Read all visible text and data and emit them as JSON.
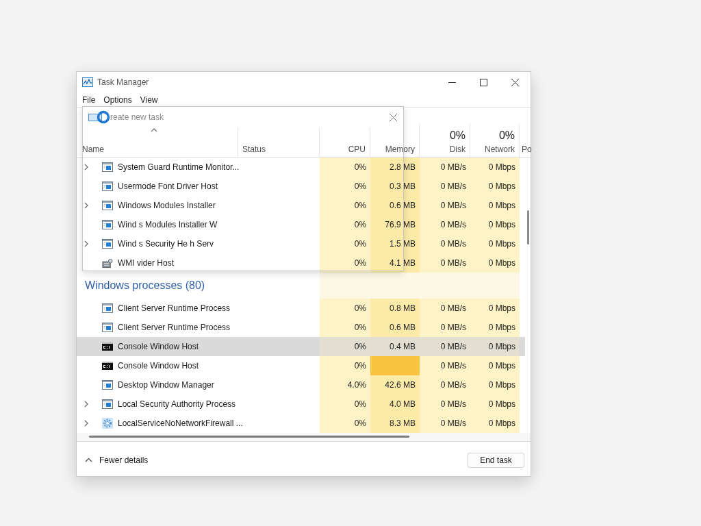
{
  "window": {
    "title": "Task Manager"
  },
  "menu": [
    "File",
    "Options",
    "View"
  ],
  "dialog": {
    "title": "reate new task"
  },
  "columns": [
    {
      "label": "Name"
    },
    {
      "label": "Status"
    },
    {
      "label": "CPU"
    },
    {
      "label": "Memory"
    },
    {
      "label": "Disk",
      "total": "0%"
    },
    {
      "label": "Network",
      "total": "0%"
    },
    {
      "label": "Po"
    }
  ],
  "rows": [
    {
      "kind": "app",
      "name": "System Guard Runtime Monitor...",
      "expandable": true,
      "selected": false,
      "memory_alert": false,
      "cpu": "0%",
      "memory": "2.8 MB",
      "disk": "0 MB/s",
      "network": "0 Mbps"
    },
    {
      "kind": "app",
      "name": "Usermode Font Driver Host",
      "expandable": false,
      "selected": false,
      "memory_alert": false,
      "cpu": "0%",
      "memory": "0.3 MB",
      "disk": "0 MB/s",
      "network": "0 Mbps"
    },
    {
      "kind": "app",
      "name": "Windows Modules Installer",
      "expandable": true,
      "selected": false,
      "memory_alert": false,
      "cpu": "0%",
      "memory": "0.6 MB",
      "disk": "0 MB/s",
      "network": "0 Mbps"
    },
    {
      "kind": "app",
      "name": "Wind      s Modules Installer W",
      "expandable": false,
      "selected": false,
      "memory_alert": false,
      "cpu": "0%",
      "memory": "76.9 MB",
      "disk": "0 MB/s",
      "network": "0 Mbps"
    },
    {
      "kind": "app",
      "name": "Wind      s Security He      h Serv",
      "expandable": true,
      "selected": false,
      "memory_alert": false,
      "cpu": "0%",
      "memory": "1.5 MB",
      "disk": "0 MB/s",
      "network": "0 Mbps"
    },
    {
      "kind": "server",
      "name": "WMI      vider Host",
      "expandable": false,
      "selected": false,
      "memory_alert": false,
      "cpu": "0%",
      "memory": "4.1 MB",
      "disk": "0 MB/s",
      "network": "0 Mbps"
    },
    {
      "kind": "group",
      "name": "Windows processes (80)",
      "selected": false
    },
    {
      "kind": "app",
      "name": "Client Server Runtime Process",
      "expandable": false,
      "selected": false,
      "memory_alert": false,
      "cpu": "0%",
      "memory": "0.8 MB",
      "disk": "0 MB/s",
      "network": "0 Mbps"
    },
    {
      "kind": "app",
      "name": "Client Server Runtime Process",
      "expandable": false,
      "selected": false,
      "memory_alert": false,
      "cpu": "0%",
      "memory": "0.6 MB",
      "disk": "0 MB/s",
      "network": "0 Mbps"
    },
    {
      "kind": "console",
      "name": "Console Window Host",
      "expandable": false,
      "selected": true,
      "memory_alert": false,
      "cpu": "0%",
      "memory": "0.4 MB",
      "disk": "0 MB/s",
      "network": "0 Mbps"
    },
    {
      "kind": "console",
      "name": "Console Window Host",
      "expandable": false,
      "selected": false,
      "memory_alert": true,
      "cpu": "0%",
      "disk": "0 MB/s",
      "network": "0 Mbps"
    },
    {
      "kind": "app",
      "name": "Desktop Window Manager",
      "expandable": false,
      "selected": false,
      "memory_alert": false,
      "cpu": "4.0%",
      "memory": "42.6 MB",
      "disk": "0 MB/s",
      "network": "0 Mbps"
    },
    {
      "kind": "app",
      "name": "Local Security Authority Process",
      "expandable": true,
      "selected": false,
      "memory_alert": false,
      "cpu": "0%",
      "memory": "4.0 MB",
      "disk": "0 MB/s",
      "network": "0 Mbps"
    },
    {
      "kind": "gear",
      "name": "LocalServiceNoNetworkFirewall ...",
      "expandable": true,
      "selected": false,
      "memory_alert": false,
      "cpu": "0%",
      "memory": "8.3 MB",
      "disk": "0 MB/s",
      "network": "0 Mbps"
    }
  ],
  "footer": {
    "toggle": "Fewer details",
    "button": "End task"
  }
}
